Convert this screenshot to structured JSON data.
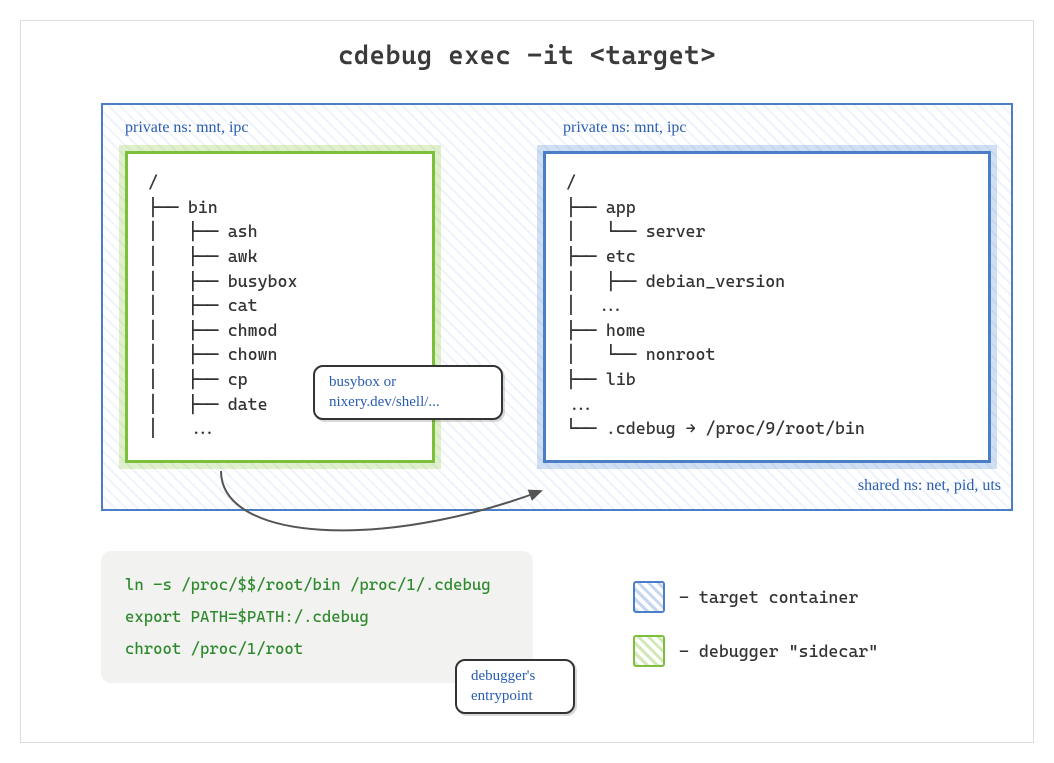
{
  "title": "cdebug exec -it <target>",
  "namespaces": {
    "private_green": "private ns:  mnt, ipc",
    "private_blue": "private ns:  mnt, ipc",
    "shared": "shared ns:  net, pid, uts"
  },
  "green_tree": {
    "root": "/",
    "l1": "├── bin",
    "l2": "│   ├── ash",
    "l3": "│   ├── awk",
    "l4": "│   ├── busybox",
    "l5": "│   ├── cat",
    "l6": "│   ├── chmod",
    "l7": "│   ├── chown",
    "l8": "│   ├── cp",
    "l9": "│   ├── date",
    "l10": "│   ..."
  },
  "blue_tree": {
    "root": "/",
    "l1": "├── app",
    "l2": "│   └── server",
    "l3": "├── etc",
    "l4": "│   ├── debian_version",
    "l5": "│  ...",
    "l6": "├── home",
    "l7": "│   └── nonroot",
    "l8": "├── lib",
    "l9": "...",
    "l10": "└── .cdebug → /proc/9/root/bin"
  },
  "busybox_callout": "busybox or nixery.dev/shell/...",
  "entrypoint_callout": "debugger's entrypoint",
  "code": {
    "l1": "ln -s /proc/$$/root/bin /proc/1/.cdebug",
    "l2": "export PATH=$PATH:/.cdebug",
    "l3": "chroot /proc/1/root"
  },
  "legend": {
    "target": "- target container",
    "sidecar": "- debugger \"sidecar\""
  }
}
